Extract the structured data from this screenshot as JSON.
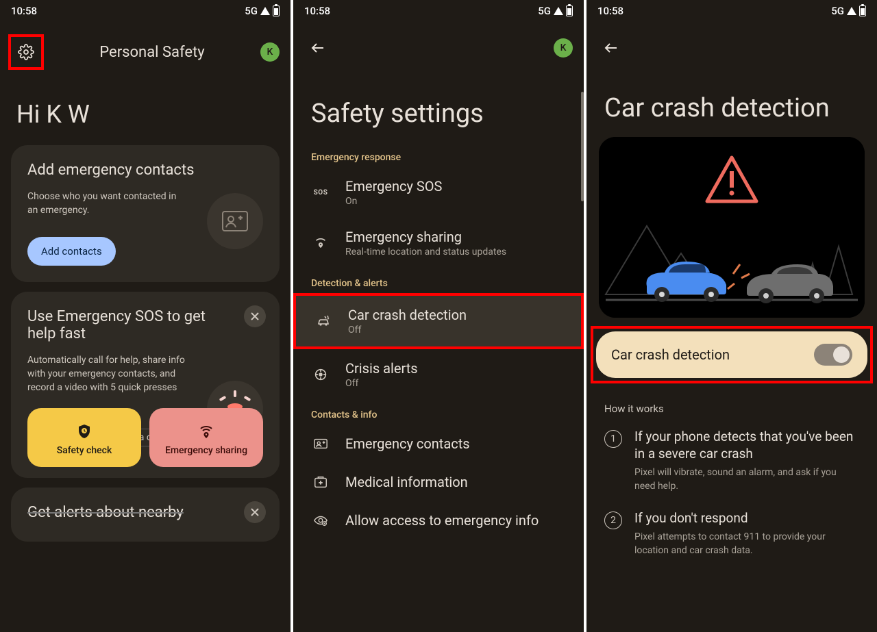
{
  "status": {
    "time": "10:58",
    "net": "5G"
  },
  "screen1": {
    "title": "Personal Safety",
    "avatar": "K",
    "greeting": "Hi K W",
    "card1": {
      "title": "Add emergency contacts",
      "desc": "Choose who you want contacted in an emergency.",
      "button": "Add contacts"
    },
    "card2": {
      "title": "Use Emergency SOS to get help fast",
      "desc": "Automatically call for help, share info with your emergency contacts, and record a video with 5 quick presses",
      "chip_hidden": "a c",
      "chip1": "Safety check",
      "chip2": "Emergency sharing"
    },
    "card3": {
      "title": "Get alerts about nearby"
    }
  },
  "screen2": {
    "title": "Safety settings",
    "avatar": "K",
    "sections": {
      "s1": "Emergency response",
      "s2": "Detection & alerts",
      "s3": "Contacts & info"
    },
    "items": {
      "sos": {
        "title": "Emergency SOS",
        "sub": "On"
      },
      "share": {
        "title": "Emergency sharing",
        "sub": "Real-time location and status updates"
      },
      "crash": {
        "title": "Car crash detection",
        "sub": "Off"
      },
      "crisis": {
        "title": "Crisis alerts",
        "sub": "Off"
      },
      "contacts": {
        "title": "Emergency contacts"
      },
      "medical": {
        "title": "Medical information"
      },
      "access": {
        "title": "Allow access to emergency info"
      }
    }
  },
  "screen3": {
    "title": "Car crash detection",
    "toggle_label": "Car crash detection",
    "hiw": "How it works",
    "step1": {
      "n": "1",
      "title": "If your phone detects that you've been in a severe car crash",
      "sub": "Pixel will vibrate, sound an alarm, and ask if you need help."
    },
    "step2": {
      "n": "2",
      "title": "If you don't respond",
      "sub": "Pixel attempts to contact 911 to provide your location and car crash data."
    }
  }
}
